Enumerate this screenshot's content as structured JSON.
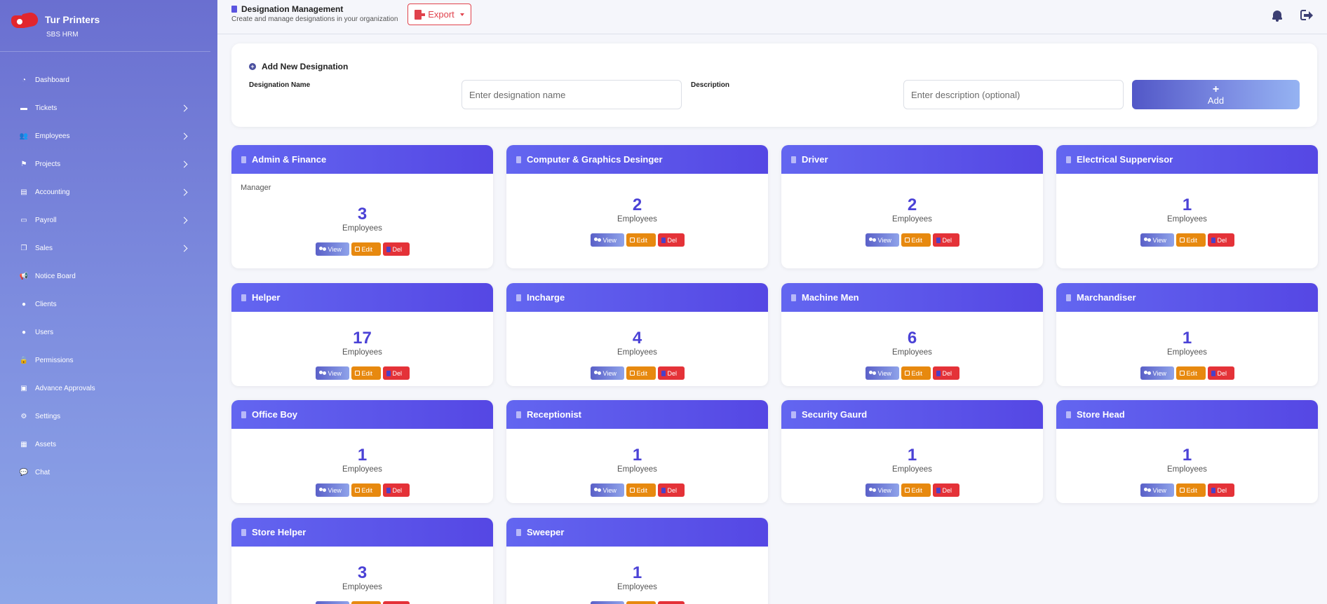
{
  "brand": {
    "title": "Tur Printers",
    "subtitle": "SBS HRM"
  },
  "sidebar": {
    "items": [
      {
        "label": "Dashboard",
        "icon": "gauge-icon",
        "glyph": "◔",
        "has_submenu": false
      },
      {
        "label": "Tickets",
        "icon": "ticket-icon",
        "glyph": "▬",
        "has_submenu": true
      },
      {
        "label": "Employees",
        "icon": "users-icon",
        "glyph": "👥",
        "has_submenu": true
      },
      {
        "label": "Projects",
        "icon": "sitemap-icon",
        "glyph": "⚑",
        "has_submenu": true
      },
      {
        "label": "Accounting",
        "icon": "file-invoice-icon",
        "glyph": "▤",
        "has_submenu": true
      },
      {
        "label": "Payroll",
        "icon": "money-bill-icon",
        "glyph": "▭",
        "has_submenu": true
      },
      {
        "label": "Sales",
        "icon": "copy-icon",
        "glyph": "❐",
        "has_submenu": true
      },
      {
        "label": "Notice Board",
        "icon": "bullhorn-icon",
        "glyph": "📢",
        "has_submenu": false
      },
      {
        "label": "Clients",
        "icon": "user-icon",
        "glyph": "●",
        "has_submenu": false
      },
      {
        "label": "Users",
        "icon": "user-gear-icon",
        "glyph": "●",
        "has_submenu": false
      },
      {
        "label": "Permissions",
        "icon": "lock-icon",
        "glyph": "🔒",
        "has_submenu": false
      },
      {
        "label": "Advance Approvals",
        "icon": "clipboard-icon",
        "glyph": "▣",
        "has_submenu": false
      },
      {
        "label": "Settings",
        "icon": "gear-icon",
        "glyph": "⚙",
        "has_submenu": false
      },
      {
        "label": "Assets",
        "icon": "boxes-icon",
        "glyph": "▦",
        "has_submenu": false
      },
      {
        "label": "Chat",
        "icon": "comment-icon",
        "glyph": "💬",
        "has_submenu": false
      }
    ]
  },
  "header": {
    "title": "Designation Management",
    "subtitle": "Create and manage designations in your organization",
    "export_label": "Export"
  },
  "add_form": {
    "title": "Add New Designation",
    "name_label": "Designation Name",
    "name_placeholder": "Enter designation name",
    "desc_label": "Description",
    "desc_placeholder": "Enter description (optional)",
    "add_plus": "+",
    "add_label": "Add"
  },
  "labels": {
    "employees": "Employees",
    "view": "View",
    "edit": "Edit",
    "del": "Del"
  },
  "designations": [
    {
      "name": "Admin & Finance",
      "description": "Manager",
      "count": "3"
    },
    {
      "name": "Computer & Graphics Desinger",
      "description": "",
      "count": "2"
    },
    {
      "name": "Driver",
      "description": "",
      "count": "2"
    },
    {
      "name": "Electrical Suppervisor",
      "description": "",
      "count": "1"
    },
    {
      "name": "Helper",
      "description": "",
      "count": "17"
    },
    {
      "name": "Incharge",
      "description": "",
      "count": "4"
    },
    {
      "name": "Machine Men",
      "description": "",
      "count": "6"
    },
    {
      "name": "Marchandiser",
      "description": "",
      "count": "1"
    },
    {
      "name": "Office Boy",
      "description": "",
      "count": "1"
    },
    {
      "name": "Receptionist",
      "description": "",
      "count": "1"
    },
    {
      "name": "Security Gaurd",
      "description": "",
      "count": "1"
    },
    {
      "name": "Store Head",
      "description": "",
      "count": "1"
    },
    {
      "name": "Store Helper",
      "description": "",
      "count": "3"
    },
    {
      "name": "Sweeper",
      "description": "",
      "count": "1"
    }
  ]
}
